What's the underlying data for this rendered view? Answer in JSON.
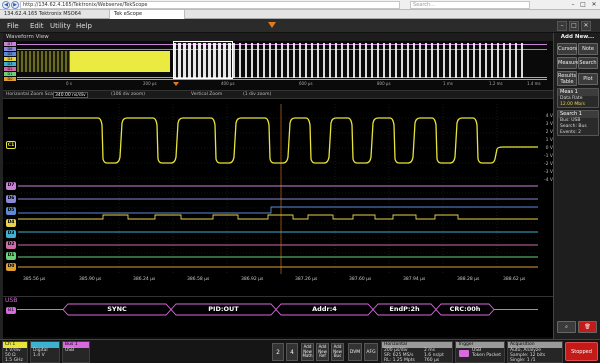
{
  "browser": {
    "url": "http://134.62.4.165/Tektronix/Webserve/TekScope",
    "search_placeholder": "Search...",
    "tabs": [
      "134.62.4.165 Tektronix MSO64",
      "Tek eScope"
    ],
    "window_controls": [
      "–",
      "□",
      "✕"
    ]
  },
  "menu": {
    "items": [
      "File",
      "Edit",
      "Utility",
      "Help"
    ]
  },
  "waveform_view": {
    "title": "Waveform View"
  },
  "overview": {
    "channel_labels": [
      "D7",
      "D6",
      "D5",
      "D4",
      "D3",
      "D2",
      "D1",
      "D0",
      "B1"
    ],
    "ticks": [
      "0 s",
      "200 μs",
      "400 μs",
      "600 μs",
      "800 μs",
      "1 ms",
      "1.2 ms",
      "1.4 ms"
    ],
    "highlight_fraction": 0.18
  },
  "zoom_toolbar": {
    "horizontal_label": "Horizontal Zoom Scale",
    "horizontal_value": "340.00 ns/div",
    "position_label": "(106 div zoom)",
    "vertical_label": "Vertical Zoom",
    "vertical_value": "(1 div zoom)"
  },
  "plot": {
    "y_labels": [
      "4 V",
      "3 V",
      "2 V",
      "1 V",
      "0 V",
      "-1 V",
      "-2 V",
      "-3 V",
      "-4 V"
    ],
    "ch1_badge": "C1",
    "digital_badges": [
      "D7",
      "D6",
      "D5",
      "D4",
      "D3",
      "D2",
      "D1",
      "D0"
    ],
    "x_ticks": [
      "385.56 μs",
      "385.90 μs",
      "386.24 μs",
      "386.58 μs",
      "386.92 μs",
      "387.26 μs",
      "387.60 μs",
      "387.94 μs",
      "388.28 μs",
      "388.62 μs"
    ],
    "colors": {
      "ch1": "#e8e23a",
      "d7": "#c983d6",
      "d6": "#8a8ad8",
      "d5": "#5a8ad8",
      "d4": "#e8d24a",
      "d3": "#3cb2d0",
      "d2": "#d06aa8",
      "d1": "#6ad07a",
      "d0": "#e0a030"
    }
  },
  "bus": {
    "name": "USB",
    "badge": "B1",
    "packets": [
      "SYNC",
      "PID:OUT",
      "Addr:4",
      "EndP:2h",
      "CRC:00h"
    ],
    "color": "#d86adf"
  },
  "right_panel": {
    "title": "Add New...",
    "buttons": [
      "Cursors",
      "Note",
      "Measure",
      "Search",
      "Results Table",
      "Plot"
    ],
    "meas": {
      "title": "Meas 1",
      "line1": "Data Rate",
      "line2": "12.00 Mb/s"
    },
    "search": {
      "title": "Search 1",
      "line1": "Bus: USB",
      "line2": "Search: Bus",
      "line3": "Events: 2"
    }
  },
  "bottom": {
    "ch1": {
      "title": "Ch 1",
      "l1": "1 V/div",
      "l2": "50 Ω",
      "l3": "1.5 GHz"
    },
    "digital": {
      "l1": "Digital",
      "l2": "1.4 V"
    },
    "bus1": {
      "title": "Bus 1",
      "l1": "USB"
    },
    "nums": [
      "2",
      "4"
    ],
    "add_buttons": [
      "Add New Math",
      "Add New Ref",
      "Add New Bus"
    ],
    "dvm": "DVM",
    "afg": "AFG",
    "horizontal": {
      "title": "Horizontal",
      "l1": "200 μs/div",
      "l2": "SR: 625 MS/s",
      "l3": "RL: 1.25 Mpts",
      "r1": "2 ms",
      "r2": "1.6 ns/pt",
      "r3": "760 μs"
    },
    "trigger": {
      "title": "Trigger",
      "l1": "USB",
      "l2": "Token Packet"
    },
    "acquisition": {
      "title": "Acquisition",
      "l1": "Auto,",
      "l1b": "Analyze",
      "l2": "Sample: 12 bits",
      "l3": "Single: 1 /1"
    },
    "stopped": "Stopped"
  }
}
